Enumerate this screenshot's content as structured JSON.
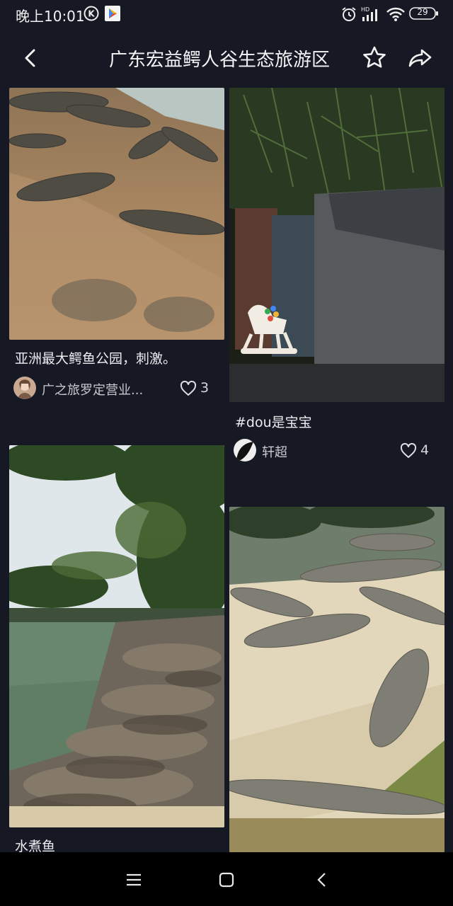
{
  "status_bar": {
    "time": "晚上10:01",
    "battery": "29",
    "icons": [
      "k-app-icon",
      "play-store-icon",
      "alarm-icon",
      "hd-signal-icon",
      "wifi-icon",
      "battery-icon"
    ]
  },
  "nav": {
    "title": "广东宏益鳄人谷生态旅游区",
    "icons": [
      "back-arrow-icon",
      "star-icon",
      "share-icon"
    ]
  },
  "feed": {
    "cards": [
      {
        "caption": "亚洲最大鳄鱼公园，刺激。",
        "author": "广之旅罗定营业...",
        "likes": "3"
      },
      {
        "caption": "#dou是宝宝",
        "author": "轩超",
        "likes": "4"
      },
      {
        "caption": "水煮鱼",
        "author": "",
        "likes": ""
      },
      {
        "caption": "",
        "author": "",
        "likes": ""
      }
    ]
  },
  "system_nav": {
    "icons": [
      "menu-icon",
      "home-square-icon",
      "back-chevron-icon"
    ]
  },
  "colors": {
    "background": "#161823",
    "text": "#ececf0",
    "muted": "#c9c9cf"
  }
}
